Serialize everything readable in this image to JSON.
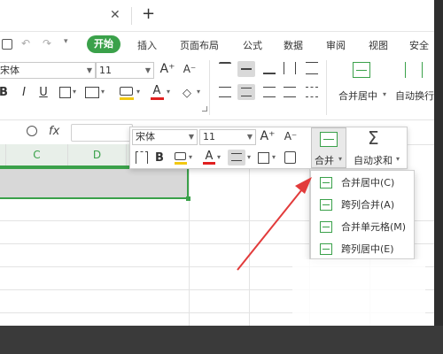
{
  "colors": {
    "accent": "#3aa14a",
    "selection_border": "#3aa14a",
    "arrow": "#e23b3b"
  },
  "window": {
    "close_label": "✕",
    "new_tab_label": "+"
  },
  "ribbon_tabs": [
    "开始",
    "插入",
    "页面布局",
    "公式",
    "数据",
    "审阅",
    "视图",
    "安全"
  ],
  "ribbon": {
    "font_name": "宋体",
    "font_size": "11",
    "bold": "B",
    "italic": "I",
    "underline": "U",
    "font_color_letter": "A",
    "grow_font": "A⁺",
    "shrink_font": "A⁻",
    "merge_center_label": "合并居中",
    "auto_wrap_label": "自动换行"
  },
  "formula_bar": {
    "fx_label": "fx"
  },
  "sheet": {
    "column_headers": [
      "C",
      "D"
    ]
  },
  "mini_toolbar": {
    "font_name": "宋体",
    "font_size": "11",
    "grow_font": "A⁺",
    "shrink_font": "A⁻",
    "bold": "B",
    "font_color_letter": "A",
    "merge_label": "合并",
    "autosum_label": "自动求和",
    "sigma": "Σ"
  },
  "merge_menu": {
    "items": [
      "合并居中(C)",
      "跨列合并(A)",
      "合并单元格(M)",
      "跨列居中(E)"
    ]
  }
}
